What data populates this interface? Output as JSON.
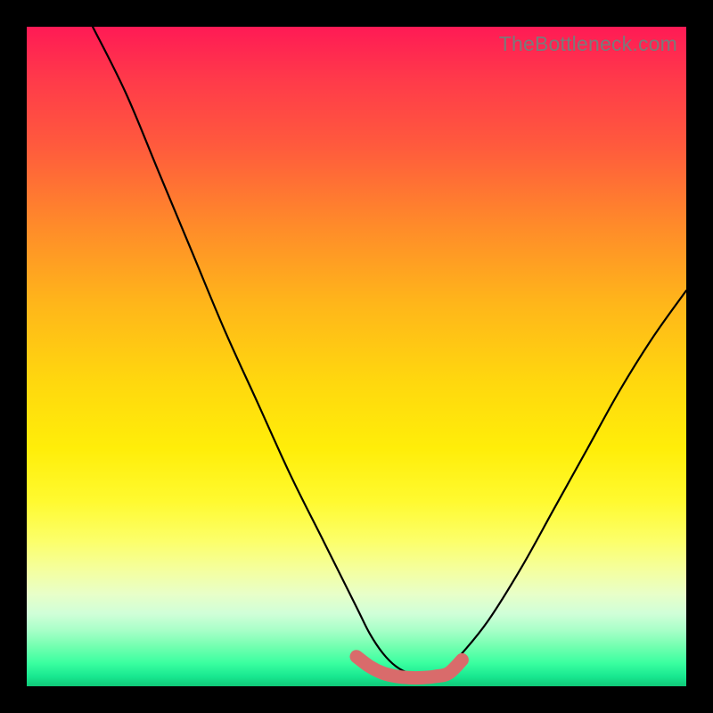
{
  "watermark": "TheBottleneck.com",
  "chart_data": {
    "type": "line",
    "title": "",
    "xlabel": "",
    "ylabel": "",
    "xlim": [
      0,
      100
    ],
    "ylim": [
      0,
      100
    ],
    "grid": false,
    "legend": false,
    "series": [
      {
        "name": "curve",
        "color": "#000000",
        "x": [
          10,
          15,
          20,
          25,
          30,
          35,
          40,
          45,
          50,
          52,
          54,
          56,
          58,
          60,
          62,
          64,
          66,
          70,
          75,
          80,
          85,
          90,
          95,
          100
        ],
        "y": [
          100,
          90,
          78,
          66,
          54,
          43,
          32,
          22,
          12,
          8,
          5,
          3,
          2,
          2,
          2,
          3,
          5,
          10,
          18,
          27,
          36,
          45,
          53,
          60
        ]
      },
      {
        "name": "bottom-band",
        "color": "#d96b6b",
        "x": [
          50,
          52,
          54,
          56,
          58,
          60,
          62,
          64,
          66
        ],
        "y": [
          4.5,
          3.0,
          2.0,
          1.5,
          1.3,
          1.3,
          1.5,
          2.0,
          4.0
        ]
      }
    ]
  }
}
